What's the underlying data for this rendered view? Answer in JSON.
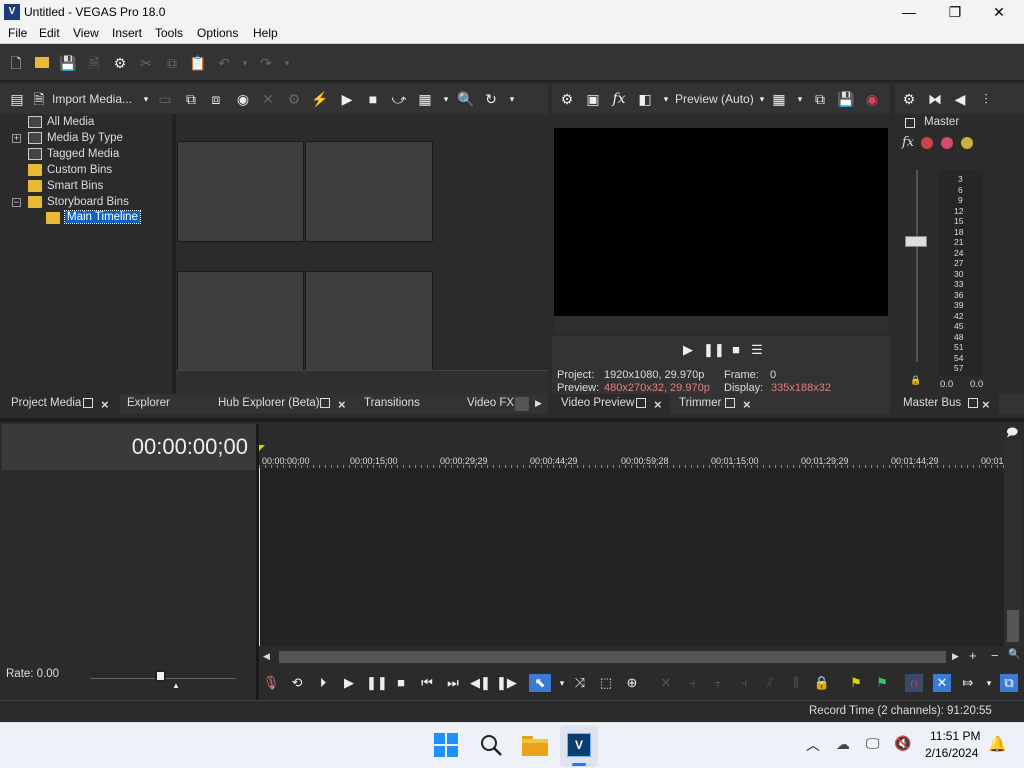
{
  "window": {
    "title": "Untitled - VEGAS Pro 18.0",
    "app_icon": "V",
    "minimize": "—",
    "maximize": "❐",
    "close": "✕"
  },
  "menu": [
    "File",
    "Edit",
    "View",
    "Insert",
    "Tools",
    "Options",
    "Help"
  ],
  "project_media": {
    "toolbar": {
      "import_label": "Import Media..."
    },
    "tree": [
      {
        "label": "All Media",
        "icon": "doc-icon"
      },
      {
        "label": "Media By Type",
        "icon": "doc-icon",
        "expander": "+"
      },
      {
        "label": "Tagged Media",
        "icon": "doc-icon"
      },
      {
        "label": "Custom Bins",
        "icon": "folder-icon"
      },
      {
        "label": "Smart Bins",
        "icon": "folder-icon"
      },
      {
        "label": "Storyboard Bins",
        "icon": "folder-icon",
        "expander": "−"
      },
      {
        "label": "Main Timeline",
        "icon": "folder-icon",
        "selected": true
      }
    ],
    "tabs": [
      "Project Media",
      "Explorer",
      "Hub Explorer (Beta)",
      "Transitions",
      "Video FX"
    ]
  },
  "preview": {
    "mode": "Preview (Auto)",
    "project_label": "Project:",
    "project_value": "1920x1080, 29.970p",
    "preview_label": "Preview:",
    "preview_value": "480x270x32, 29.970p",
    "frame_label": "Frame:",
    "frame_value": "0",
    "display_label": "Display:",
    "display_value": "335x188x32",
    "tabs": [
      "Video Preview",
      "Trimmer"
    ]
  },
  "master_bus": {
    "label": "Master",
    "scale": [
      "3",
      "6",
      "9",
      "12",
      "15",
      "18",
      "21",
      "24",
      "27",
      "30",
      "33",
      "36",
      "39",
      "42",
      "45",
      "48",
      "51",
      "54",
      "57"
    ],
    "left_value": "0.0",
    "right_value": "0.0",
    "tab": "Master Bus"
  },
  "timeline": {
    "timecode": "00:00:00;00",
    "ruler": [
      "00:00:00;00",
      "00:00:15;00",
      "00:00:29;29",
      "00:00:44;29",
      "00:00:59;28",
      "00:01:15;00",
      "00:01:29;29",
      "00:01:44;29",
      "00:01"
    ],
    "rate": "Rate: 0.00",
    "record_time": "Record Time (2 channels): 91:20:55"
  },
  "taskbar": {
    "time": "11:51 PM",
    "date": "2/16/2024"
  },
  "colors": {
    "accent": "#0e62c7",
    "folder": "#e8b934",
    "preview_red": "#e07f7f"
  }
}
